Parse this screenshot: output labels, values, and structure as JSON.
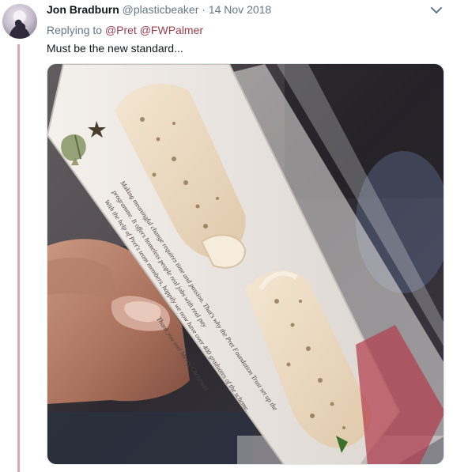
{
  "tweet": {
    "display_name": "Jon Bradburn",
    "handle": "@plasticbeaker",
    "separator": "·",
    "date": "14 Nov 2018",
    "reply_prefix": "Replying to",
    "reply_mentions": [
      "@Pret",
      "@FWPalmer"
    ],
    "text": "Must be the new standard...",
    "media": {
      "type": "photo",
      "packaging_text_lines": [
        "Making meaningful change requires time and passion. That's why the Pret Foundation Trust set up the",
        "programme. It offers homeless people real jobs with real pay",
        "With the help of Pret's team members, happily we now have over 400 graduates of the scheme.",
        "Thank you and Merry Christmas"
      ]
    }
  },
  "colors": {
    "accent": "#9a3d4e",
    "thread_line": "#d8a8b3",
    "muted": "#657786"
  },
  "icons": {
    "menu": "chevron-down-icon"
  }
}
